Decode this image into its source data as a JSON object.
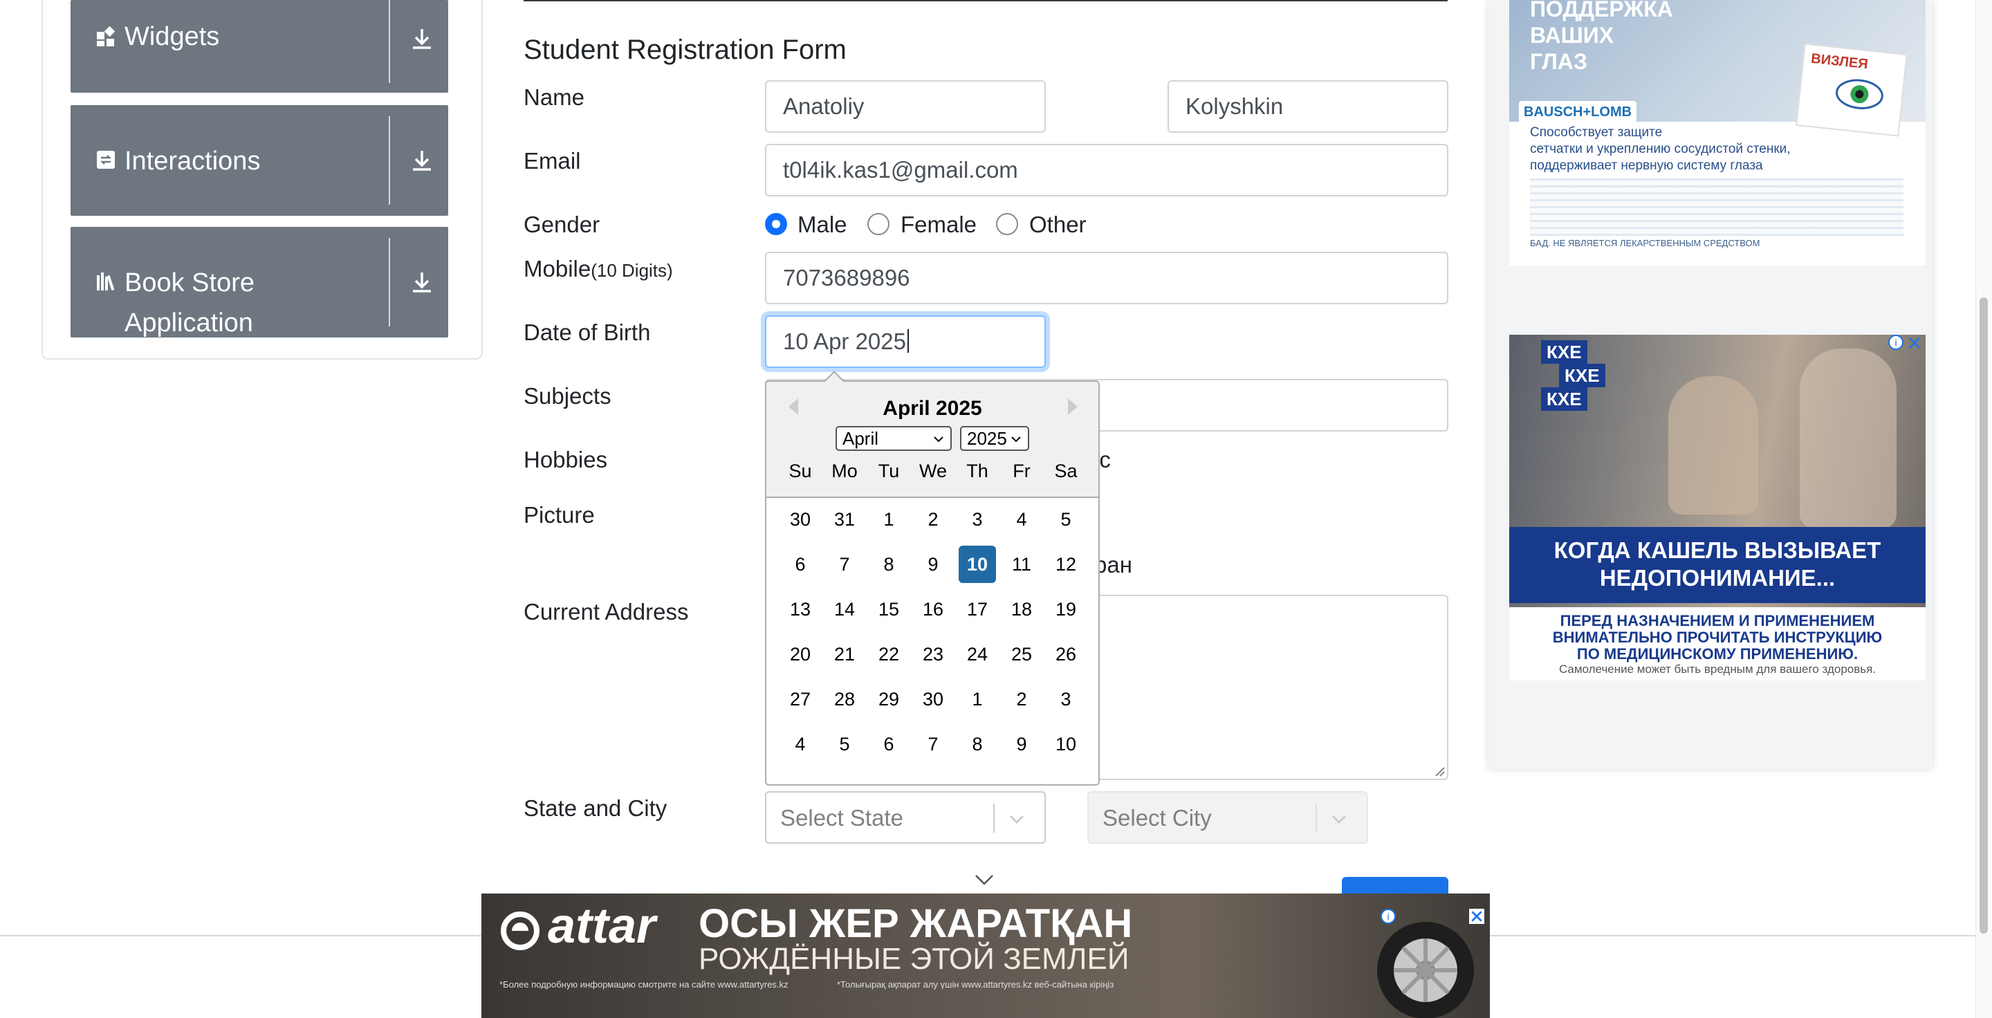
{
  "sidebar": {
    "groups": [
      {
        "label": "Widgets",
        "icon": "widgets-icon"
      },
      {
        "label": "Interactions",
        "icon": "interactions-icon"
      },
      {
        "label": "Book Store",
        "label2": "Application",
        "icon": "bookstore-icon"
      }
    ]
  },
  "form": {
    "title": "Student Registration Form",
    "name_label": "Name",
    "first_name": "Anatoliy",
    "last_name": "Kolyshkin",
    "email_label": "Email",
    "email": "t0l4ik.kas1@gmail.com",
    "gender_label": "Gender",
    "gender_options": [
      "Male",
      "Female",
      "Other"
    ],
    "gender_selected": "Male",
    "mobile_label": "Mobile",
    "mobile_hint": "(10 Digits)",
    "mobile": "7073689896",
    "dob_label": "Date of Birth",
    "dob": "10 Apr 2025",
    "subjects_label": "Subjects",
    "hobbies_label": "Hobbies",
    "hobbies_visible_fragment": "ic",
    "picture_label": "Picture",
    "picture_visible_fragment": "ран",
    "address_label": "Current Address",
    "state_city_label": "State and City",
    "state_placeholder": "Select State",
    "city_placeholder": "Select City"
  },
  "datepicker": {
    "title": "April 2025",
    "month_select": "April",
    "year_select": "2025",
    "day_names": [
      "Su",
      "Mo",
      "Tu",
      "We",
      "Th",
      "Fr",
      "Sa"
    ],
    "weeks": [
      [
        "30",
        "31",
        "1",
        "2",
        "3",
        "4",
        "5"
      ],
      [
        "6",
        "7",
        "8",
        "9",
        "10",
        "11",
        "12"
      ],
      [
        "13",
        "14",
        "15",
        "16",
        "17",
        "18",
        "19"
      ],
      [
        "20",
        "21",
        "22",
        "23",
        "24",
        "25",
        "26"
      ],
      [
        "27",
        "28",
        "29",
        "30",
        "1",
        "2",
        "3"
      ],
      [
        "4",
        "5",
        "6",
        "7",
        "8",
        "9",
        "10"
      ]
    ],
    "selected_day": "10"
  },
  "ads": {
    "ad1": {
      "headline": [
        "ПОДДЕРЖКА",
        "ВАШИХ",
        "ГЛАЗ"
      ],
      "brand": "BAUSCH+LOMB",
      "product": "ВИЗЛЕЯ",
      "body": [
        "Способствует защите",
        "сетчатки и укреплению сосудистой стенки,",
        "поддерживает нервную систему глаза"
      ],
      "disclaimer": "БАД. НЕ ЯВЛЯЕТСЯ ЛЕКАРСТВЕННЫМ СРЕДСТВОМ"
    },
    "ad2": {
      "tag": [
        "КХЕ",
        "КХЕ",
        "КХЕ"
      ],
      "headline": [
        "КОГДА КАШЕЛЬ ВЫЗЫВАЕТ",
        "НЕДОПОНИМАНИЕ..."
      ],
      "body": [
        "ПЕРЕД НАЗНАЧЕНИЕМ И ПРИМЕНЕНИЕМ",
        "ВНИМАТЕЛЬНО ПРОЧИТАТЬ ИНСТРУКЦИЮ",
        "ПО МЕДИЦИНСКОМУ ПРИМЕНЕНИЮ."
      ],
      "footer": "Самолечение может быть вредным для вашего здоровья."
    },
    "banner": {
      "brand": "attar",
      "headline": "ОСЫ ЖЕР ЖАРАТҚАН",
      "subline": "РОЖДЁННЫЕ ЭТОЙ ЗЕМЛЕЙ",
      "fine1": "*Более подробную информацию смотрите на сайте www.attartyres.kz",
      "fine2": "*Толығырақ ақпарат алу үшін www.attartyres.kz веб-сайтына кіріңіз"
    }
  },
  "colors": {
    "sidebar_header": "#6e7780",
    "selected_day": "#216ba5",
    "radio_checked": "#0d6efd",
    "submit_button": "#1a73e8"
  }
}
